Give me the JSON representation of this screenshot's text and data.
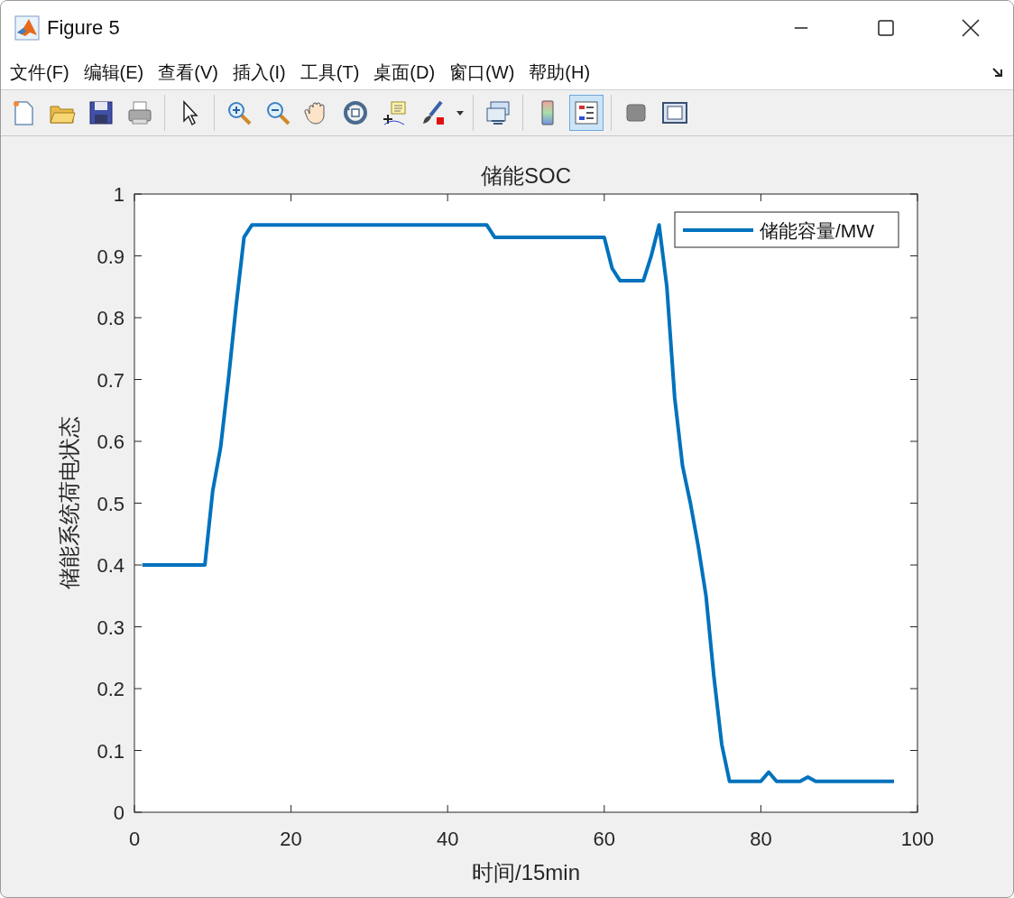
{
  "window": {
    "title": "Figure 5"
  },
  "menu": [
    "文件(F)",
    "编辑(E)",
    "查看(V)",
    "插入(I)",
    "工具(T)",
    "桌面(D)",
    "窗口(W)",
    "帮助(H)"
  ],
  "toolbar": [
    {
      "kind": "new-file",
      "pressed": false
    },
    {
      "kind": "open-folder",
      "pressed": false
    },
    {
      "kind": "save",
      "pressed": false
    },
    {
      "kind": "print",
      "pressed": false
    },
    {
      "kind": "separator"
    },
    {
      "kind": "pointer",
      "pressed": false
    },
    {
      "kind": "separator"
    },
    {
      "kind": "zoom-in",
      "pressed": false
    },
    {
      "kind": "zoom-out",
      "pressed": false
    },
    {
      "kind": "pan",
      "pressed": false
    },
    {
      "kind": "rotate",
      "pressed": false
    },
    {
      "kind": "data-cursor",
      "pressed": false
    },
    {
      "kind": "brush",
      "pressed": false
    },
    {
      "kind": "dropdown",
      "pressed": false
    },
    {
      "kind": "separator"
    },
    {
      "kind": "link",
      "pressed": false
    },
    {
      "kind": "separator"
    },
    {
      "kind": "colorbar",
      "pressed": false
    },
    {
      "kind": "legend",
      "pressed": true
    },
    {
      "kind": "separator"
    },
    {
      "kind": "hide-tools",
      "pressed": false
    },
    {
      "kind": "show-tools",
      "pressed": false
    }
  ],
  "figure": {
    "chart_data": {
      "type": "line",
      "title": "储能SOC",
      "xlabel": "时间/15min",
      "ylabel": "储能系统荷电状态",
      "x": [
        1,
        9,
        10,
        11,
        12,
        13,
        14,
        15,
        45,
        46,
        60,
        61,
        62,
        65,
        66,
        67,
        68,
        69,
        70,
        71,
        72,
        73,
        74,
        75,
        76,
        80,
        81,
        82,
        85,
        86,
        87,
        97
      ],
      "series": [
        {
          "name": "储能容量/MW",
          "color": "#0072bd",
          "values": [
            0.4,
            0.4,
            0.52,
            0.59,
            0.7,
            0.82,
            0.93,
            0.95,
            0.95,
            0.93,
            0.93,
            0.88,
            0.86,
            0.86,
            0.9,
            0.95,
            0.85,
            0.67,
            0.56,
            0.5,
            0.43,
            0.35,
            0.22,
            0.11,
            0.05,
            0.05,
            0.065,
            0.05,
            0.05,
            0.057,
            0.05,
            0.05
          ]
        }
      ],
      "xlim": [
        0,
        100
      ],
      "ylim": [
        0,
        1
      ],
      "xticks": [
        0,
        20,
        40,
        60,
        80,
        100
      ],
      "yticks": [
        0,
        0.1,
        0.2,
        0.3,
        0.4,
        0.5,
        0.6,
        0.7,
        0.8,
        0.9,
        1
      ]
    }
  }
}
